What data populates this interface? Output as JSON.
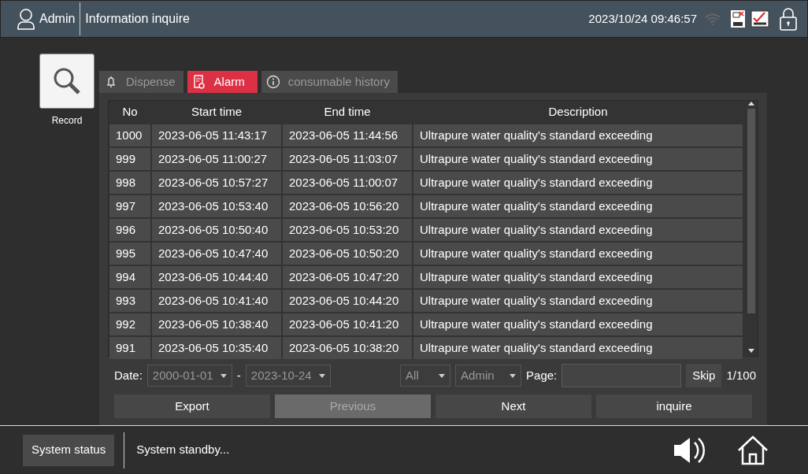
{
  "header": {
    "user": "Admin",
    "title": "Information inquire",
    "datetime": "2023/10/24 09:46:57"
  },
  "side_button": {
    "label": "Record"
  },
  "tabs": [
    {
      "label": "Dispense",
      "selected": false
    },
    {
      "label": "Alarm",
      "selected": true
    },
    {
      "label": "consumable history",
      "selected": false
    }
  ],
  "table": {
    "columns": [
      "No",
      "Start time",
      "End time",
      "Description"
    ],
    "rows": [
      [
        "1000",
        "2023-06-05 11:43:17",
        "2023-06-05 11:44:56",
        "Ultrapure water quality's standard exceeding"
      ],
      [
        "999",
        "2023-06-05 11:00:27",
        "2023-06-05 11:03:07",
        "Ultrapure water quality's standard exceeding"
      ],
      [
        "998",
        "2023-06-05 10:57:27",
        "2023-06-05 11:00:07",
        "Ultrapure water quality's standard exceeding"
      ],
      [
        "997",
        "2023-06-05 10:53:40",
        "2023-06-05 10:56:20",
        "Ultrapure water quality's standard exceeding"
      ],
      [
        "996",
        "2023-06-05 10:50:40",
        "2023-06-05 10:53:20",
        "Ultrapure water quality's standard exceeding"
      ],
      [
        "995",
        "2023-06-05 10:47:40",
        "2023-06-05 10:50:20",
        "Ultrapure water quality's standard exceeding"
      ],
      [
        "994",
        "2023-06-05 10:44:40",
        "2023-06-05 10:47:20",
        "Ultrapure water quality's standard exceeding"
      ],
      [
        "993",
        "2023-06-05 10:41:40",
        "2023-06-05 10:44:20",
        "Ultrapure water quality's standard exceeding"
      ],
      [
        "992",
        "2023-06-05 10:38:40",
        "2023-06-05 10:41:20",
        "Ultrapure water quality's standard exceeding"
      ],
      [
        "991",
        "2023-06-05 10:35:40",
        "2023-06-05 10:38:20",
        "Ultrapure water quality's standard exceeding"
      ]
    ]
  },
  "filters": {
    "date_label": "Date:",
    "date_from": "2000-01-01",
    "separator": "-",
    "date_to": "2023-10-24",
    "type": "All",
    "user": "Admin",
    "page_label": "Page:",
    "skip": "Skip",
    "page_count": "1/100"
  },
  "buttons": [
    {
      "label": "Export",
      "disabled": false
    },
    {
      "label": "Previous",
      "disabled": true
    },
    {
      "label": "Next",
      "disabled": false
    },
    {
      "label": "inquire",
      "disabled": false
    }
  ],
  "status_bar": {
    "button": "System status",
    "message": "System standby..."
  }
}
